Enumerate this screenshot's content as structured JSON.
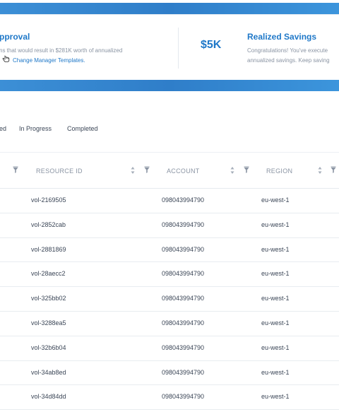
{
  "banner": {
    "approval": {
      "title": "pproval",
      "line1": "ns that would result in $281K worth of annualized",
      "line2_link": "Change Manager Templates."
    },
    "realized": {
      "amount": "$5K",
      "title": "Realized Savings",
      "line1": "Congratulations! You've execute",
      "line2": "annualized savings. Keep saving"
    }
  },
  "tabs": [
    {
      "label": "ed"
    },
    {
      "label": "In Progress"
    },
    {
      "label": "Completed"
    }
  ],
  "table": {
    "columns": [
      "RESOURCE ID",
      "ACCOUNT",
      "REGION"
    ],
    "rows": [
      {
        "resource_id": "vol-2169505",
        "account": "098043994790",
        "region": "eu-west-1"
      },
      {
        "resource_id": "vol-2852cab",
        "account": "098043994790",
        "region": "eu-west-1"
      },
      {
        "resource_id": "vol-2881869",
        "account": "098043994790",
        "region": "eu-west-1"
      },
      {
        "resource_id": "vol-28aecc2",
        "account": "098043994790",
        "region": "eu-west-1"
      },
      {
        "resource_id": "vol-325bb02",
        "account": "098043994790",
        "region": "eu-west-1"
      },
      {
        "resource_id": "vol-3288ea5",
        "account": "098043994790",
        "region": "eu-west-1"
      },
      {
        "resource_id": "vol-32b6b04",
        "account": "098043994790",
        "region": "eu-west-1"
      },
      {
        "resource_id": "vol-34ab8ed",
        "account": "098043994790",
        "region": "eu-west-1"
      },
      {
        "resource_id": "vol-34d84dd",
        "account": "098043994790",
        "region": "eu-west-1"
      }
    ]
  },
  "colors": {
    "accent": "#1f78c8",
    "banner": "#3c8fd6"
  },
  "icons": [
    "hand-cursor-icon",
    "sort-icon",
    "filter-icon"
  ]
}
